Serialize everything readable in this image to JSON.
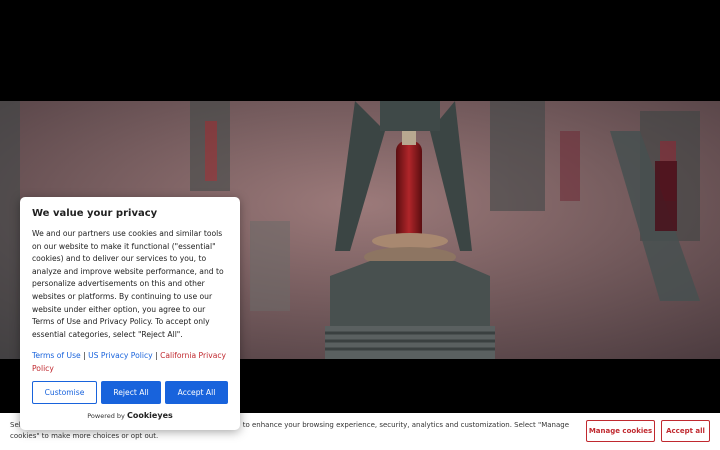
{
  "consent_modal": {
    "title": "We value your privacy",
    "body": "We and our partners use cookies and similar tools on our website to make it functional (\"essential\" cookies) and to deliver our services to you, to analyze and improve website performance, and to personalize advertisements on this and other websites or platforms. By continuing to use our website under either option, you agree to our Terms of Use and Privacy Policy. To accept only essential categories, select \"Reject All\".",
    "link_terms": "Terms of Use",
    "separator": "|",
    "link_us_privacy": "US Privacy Policy",
    "link_california": "California Privacy Policy",
    "customise_label": "Customise",
    "reject_label": "Reject All",
    "accept_label": "Accept All",
    "powered_by": "Powered by",
    "brand": "Cookieyes"
  },
  "bottom_banner": {
    "text_start": "Sel",
    "text_end": "to enhance your browsing experience, security, analytics and customization. Select \"Manage cookies\" to make more choices or opt out.",
    "manage_label": "Manage cookies",
    "accept_label": "Accept all"
  },
  "colors": {
    "accent_blue": "#1863dc",
    "accent_red": "#c0292f"
  }
}
